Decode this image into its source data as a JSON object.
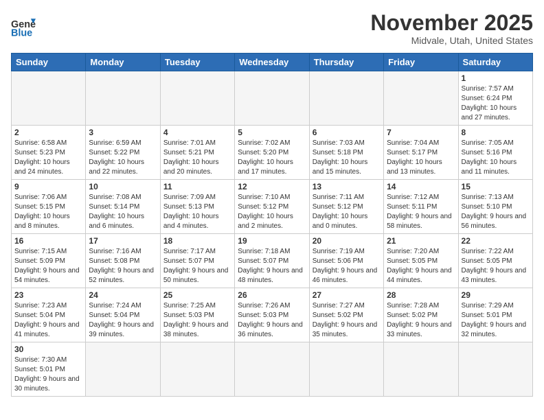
{
  "header": {
    "logo_general": "General",
    "logo_blue": "Blue",
    "month_title": "November 2025",
    "location": "Midvale, Utah, United States"
  },
  "weekdays": [
    "Sunday",
    "Monday",
    "Tuesday",
    "Wednesday",
    "Thursday",
    "Friday",
    "Saturday"
  ],
  "weeks": [
    [
      {
        "day": "",
        "info": ""
      },
      {
        "day": "",
        "info": ""
      },
      {
        "day": "",
        "info": ""
      },
      {
        "day": "",
        "info": ""
      },
      {
        "day": "",
        "info": ""
      },
      {
        "day": "",
        "info": ""
      },
      {
        "day": "1",
        "info": "Sunrise: 7:57 AM\nSunset: 6:24 PM\nDaylight: 10 hours and 27 minutes."
      }
    ],
    [
      {
        "day": "2",
        "info": "Sunrise: 6:58 AM\nSunset: 5:23 PM\nDaylight: 10 hours and 24 minutes."
      },
      {
        "day": "3",
        "info": "Sunrise: 6:59 AM\nSunset: 5:22 PM\nDaylight: 10 hours and 22 minutes."
      },
      {
        "day": "4",
        "info": "Sunrise: 7:01 AM\nSunset: 5:21 PM\nDaylight: 10 hours and 20 minutes."
      },
      {
        "day": "5",
        "info": "Sunrise: 7:02 AM\nSunset: 5:20 PM\nDaylight: 10 hours and 17 minutes."
      },
      {
        "day": "6",
        "info": "Sunrise: 7:03 AM\nSunset: 5:18 PM\nDaylight: 10 hours and 15 minutes."
      },
      {
        "day": "7",
        "info": "Sunrise: 7:04 AM\nSunset: 5:17 PM\nDaylight: 10 hours and 13 minutes."
      },
      {
        "day": "8",
        "info": "Sunrise: 7:05 AM\nSunset: 5:16 PM\nDaylight: 10 hours and 11 minutes."
      }
    ],
    [
      {
        "day": "9",
        "info": "Sunrise: 7:06 AM\nSunset: 5:15 PM\nDaylight: 10 hours and 8 minutes."
      },
      {
        "day": "10",
        "info": "Sunrise: 7:08 AM\nSunset: 5:14 PM\nDaylight: 10 hours and 6 minutes."
      },
      {
        "day": "11",
        "info": "Sunrise: 7:09 AM\nSunset: 5:13 PM\nDaylight: 10 hours and 4 minutes."
      },
      {
        "day": "12",
        "info": "Sunrise: 7:10 AM\nSunset: 5:12 PM\nDaylight: 10 hours and 2 minutes."
      },
      {
        "day": "13",
        "info": "Sunrise: 7:11 AM\nSunset: 5:12 PM\nDaylight: 10 hours and 0 minutes."
      },
      {
        "day": "14",
        "info": "Sunrise: 7:12 AM\nSunset: 5:11 PM\nDaylight: 9 hours and 58 minutes."
      },
      {
        "day": "15",
        "info": "Sunrise: 7:13 AM\nSunset: 5:10 PM\nDaylight: 9 hours and 56 minutes."
      }
    ],
    [
      {
        "day": "16",
        "info": "Sunrise: 7:15 AM\nSunset: 5:09 PM\nDaylight: 9 hours and 54 minutes."
      },
      {
        "day": "17",
        "info": "Sunrise: 7:16 AM\nSunset: 5:08 PM\nDaylight: 9 hours and 52 minutes."
      },
      {
        "day": "18",
        "info": "Sunrise: 7:17 AM\nSunset: 5:07 PM\nDaylight: 9 hours and 50 minutes."
      },
      {
        "day": "19",
        "info": "Sunrise: 7:18 AM\nSunset: 5:07 PM\nDaylight: 9 hours and 48 minutes."
      },
      {
        "day": "20",
        "info": "Sunrise: 7:19 AM\nSunset: 5:06 PM\nDaylight: 9 hours and 46 minutes."
      },
      {
        "day": "21",
        "info": "Sunrise: 7:20 AM\nSunset: 5:05 PM\nDaylight: 9 hours and 44 minutes."
      },
      {
        "day": "22",
        "info": "Sunrise: 7:22 AM\nSunset: 5:05 PM\nDaylight: 9 hours and 43 minutes."
      }
    ],
    [
      {
        "day": "23",
        "info": "Sunrise: 7:23 AM\nSunset: 5:04 PM\nDaylight: 9 hours and 41 minutes."
      },
      {
        "day": "24",
        "info": "Sunrise: 7:24 AM\nSunset: 5:04 PM\nDaylight: 9 hours and 39 minutes."
      },
      {
        "day": "25",
        "info": "Sunrise: 7:25 AM\nSunset: 5:03 PM\nDaylight: 9 hours and 38 minutes."
      },
      {
        "day": "26",
        "info": "Sunrise: 7:26 AM\nSunset: 5:03 PM\nDaylight: 9 hours and 36 minutes."
      },
      {
        "day": "27",
        "info": "Sunrise: 7:27 AM\nSunset: 5:02 PM\nDaylight: 9 hours and 35 minutes."
      },
      {
        "day": "28",
        "info": "Sunrise: 7:28 AM\nSunset: 5:02 PM\nDaylight: 9 hours and 33 minutes."
      },
      {
        "day": "29",
        "info": "Sunrise: 7:29 AM\nSunset: 5:01 PM\nDaylight: 9 hours and 32 minutes."
      }
    ],
    [
      {
        "day": "30",
        "info": "Sunrise: 7:30 AM\nSunset: 5:01 PM\nDaylight: 9 hours and 30 minutes."
      },
      {
        "day": "",
        "info": ""
      },
      {
        "day": "",
        "info": ""
      },
      {
        "day": "",
        "info": ""
      },
      {
        "day": "",
        "info": ""
      },
      {
        "day": "",
        "info": ""
      },
      {
        "day": "",
        "info": ""
      }
    ]
  ]
}
